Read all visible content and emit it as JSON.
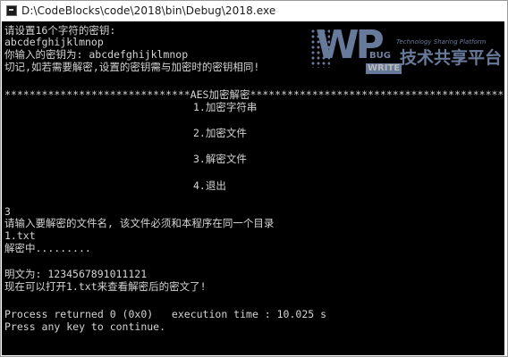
{
  "window": {
    "title": "D:\\CodeBlocks\\code\\2018\\bin\\Debug\\2018.exe"
  },
  "console": {
    "lines": [
      "请设置16个字符的密钥:",
      "abcdefghijklmnop",
      "你输入的密钥为: abcdefghijklmnop",
      "切记,如若需要解密,设置的密钥需与加密时的密钥相同!",
      "******************************AES加密解密******************************************",
      "1.加密字符串",
      "2.加密文件",
      "3.解密文件",
      "4.退出",
      "3",
      "请输入要解密的文件名, 该文件必须和本程序在同一个目录",
      "1.txt",
      "解密中.........",
      "明文为: 1234567891011121",
      "现在可以打开1.txt来查看解密后的密文了!",
      "Process returned 0 (0x0)   execution time : 10.025 s",
      "Press any key to continue."
    ]
  },
  "watermark": {
    "logo_letters": "WP",
    "bug": "BUG",
    "write": "WRITE",
    "tagline": "Technology Sharing Platform",
    "chinese": "技术共享平台"
  },
  "colors": {
    "console_bg": "#000000",
    "console_text": "#d4d4d4",
    "watermark": "#8fa9d6"
  }
}
